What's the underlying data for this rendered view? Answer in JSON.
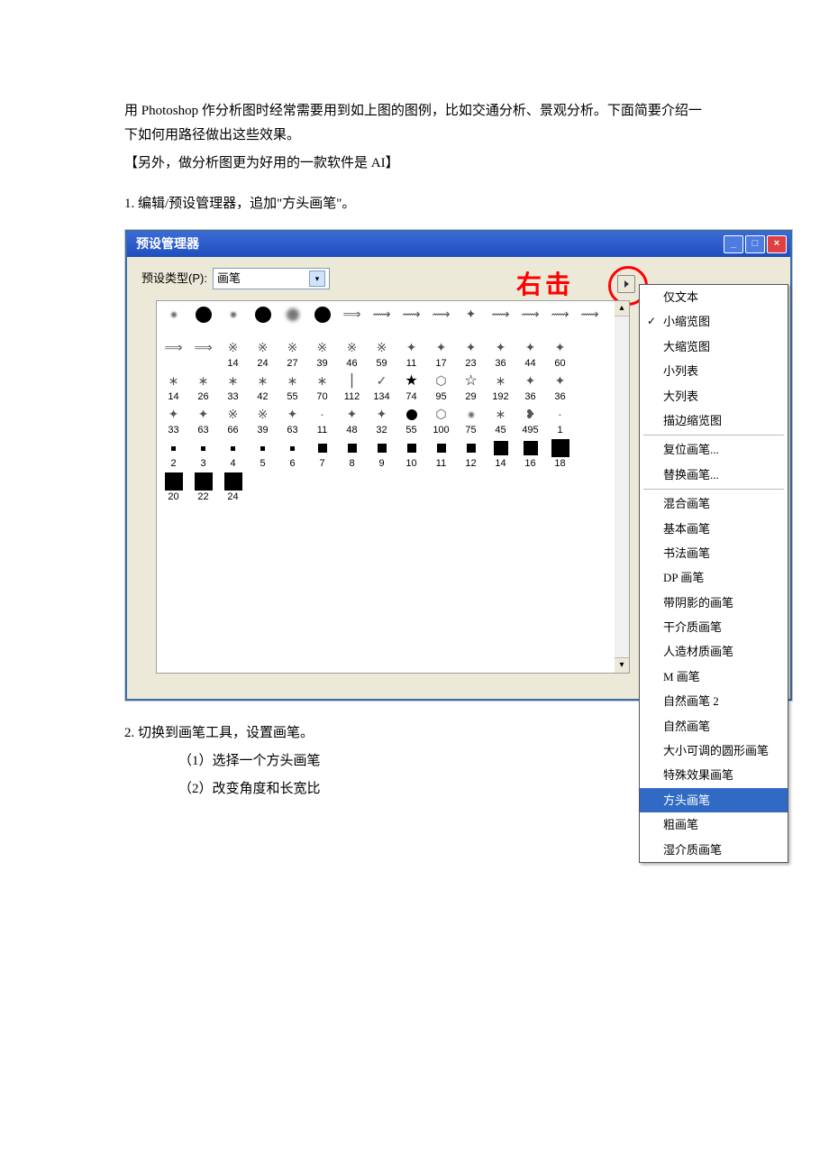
{
  "paragraphs": {
    "p1": "用 Photoshop 作分析图时经常需要用到如上图的图例，比如交通分析、景观分析。下面简要介绍一下如何用路径做出这些效果。",
    "p2": "【另外，做分析图更为好用的一款软件是 AI】",
    "p3": "1. 编辑/预设管理器，追加\"方头画笔\"。",
    "p4": "2. 切换到画笔工具，设置画笔。",
    "p5": "（1）选择一个方头画笔",
    "p6": "（2）改变角度和长宽比"
  },
  "dialog": {
    "title": "预设管理器",
    "preset_type_label": "预设类型(P):",
    "preset_type_value": "画笔",
    "annotation": "右击"
  },
  "brush_grid": [
    {
      "t": "circ-s",
      "l": ""
    },
    {
      "t": "circ-l",
      "l": ""
    },
    {
      "t": "circ-s",
      "l": ""
    },
    {
      "t": "circ-l",
      "l": ""
    },
    {
      "t": "circ-fuzz",
      "l": ""
    },
    {
      "t": "circ-l",
      "l": ""
    },
    {
      "t": "splat",
      "g": "⟹",
      "l": ""
    },
    {
      "t": "splat",
      "g": "⟿",
      "l": ""
    },
    {
      "t": "splat",
      "g": "⟿",
      "l": ""
    },
    {
      "t": "splat",
      "g": "⟿",
      "l": ""
    },
    {
      "t": "splat",
      "g": "✦",
      "l": ""
    },
    {
      "t": "splat",
      "g": "⟿",
      "l": ""
    },
    {
      "t": "splat",
      "g": "⟿",
      "l": ""
    },
    {
      "t": "splat",
      "g": "⟿",
      "l": ""
    },
    {
      "t": "splat",
      "g": "⟿",
      "l": ""
    },
    {
      "t": "splat",
      "g": "⟹",
      "l": ""
    },
    {
      "t": "splat",
      "g": "⟹",
      "l": ""
    },
    {
      "t": "splat",
      "g": "※",
      "l": "14"
    },
    {
      "t": "splat",
      "g": "※",
      "l": "24"
    },
    {
      "t": "splat",
      "g": "※",
      "l": "27"
    },
    {
      "t": "splat",
      "g": "※",
      "l": "39"
    },
    {
      "t": "splat",
      "g": "※",
      "l": "46"
    },
    {
      "t": "splat",
      "g": "※",
      "l": "59"
    },
    {
      "t": "splat",
      "g": "✦",
      "l": "11"
    },
    {
      "t": "splat",
      "g": "✦",
      "l": "17"
    },
    {
      "t": "splat",
      "g": "✦",
      "l": "23"
    },
    {
      "t": "splat",
      "g": "✦",
      "l": "36"
    },
    {
      "t": "splat",
      "g": "✦",
      "l": "44"
    },
    {
      "t": "splat",
      "g": "✦",
      "l": "60"
    },
    {
      "t": "",
      "l": ""
    },
    {
      "t": "splat",
      "g": "∗",
      "l": "14"
    },
    {
      "t": "splat",
      "g": "∗",
      "l": "26"
    },
    {
      "t": "splat",
      "g": "∗",
      "l": "33"
    },
    {
      "t": "splat",
      "g": "∗",
      "l": "42"
    },
    {
      "t": "splat",
      "g": "∗",
      "l": "55"
    },
    {
      "t": "splat",
      "g": "∗",
      "l": "70"
    },
    {
      "t": "splat",
      "g": "⎮",
      "l": "112"
    },
    {
      "t": "splat",
      "g": "✓",
      "l": "134"
    },
    {
      "t": "star",
      "g": "★",
      "l": "74"
    },
    {
      "t": "splat",
      "g": "⬡",
      "l": "95"
    },
    {
      "t": "star",
      "g": "☆",
      "l": "29"
    },
    {
      "t": "splat",
      "g": "∗",
      "l": "192"
    },
    {
      "t": "splat",
      "g": "✦",
      "l": "36"
    },
    {
      "t": "splat",
      "g": "✦",
      "l": "36"
    },
    {
      "t": "",
      "l": ""
    },
    {
      "t": "splat",
      "g": "✦",
      "l": "33"
    },
    {
      "t": "splat",
      "g": "✦",
      "l": "63"
    },
    {
      "t": "splat",
      "g": "※",
      "l": "66"
    },
    {
      "t": "splat",
      "g": "※",
      "l": "39"
    },
    {
      "t": "splat",
      "g": "✦",
      "l": "63"
    },
    {
      "t": "splat",
      "g": "·",
      "l": "11"
    },
    {
      "t": "splat",
      "g": "✦",
      "l": "48"
    },
    {
      "t": "splat",
      "g": "✦",
      "l": "32"
    },
    {
      "t": "circ-m",
      "l": "55"
    },
    {
      "t": "splat",
      "g": "⬡",
      "l": "100"
    },
    {
      "t": "circ-s",
      "l": "75"
    },
    {
      "t": "splat",
      "g": "∗",
      "l": "45"
    },
    {
      "t": "splat",
      "g": "❥",
      "l": "495"
    },
    {
      "t": "splat",
      "g": "·",
      "l": "1"
    },
    {
      "t": "",
      "l": ""
    },
    {
      "t": "sq-s",
      "l": "2"
    },
    {
      "t": "sq-s",
      "l": "3"
    },
    {
      "t": "sq-s",
      "l": "4"
    },
    {
      "t": "sq-s",
      "l": "5"
    },
    {
      "t": "sq-s",
      "l": "6"
    },
    {
      "t": "sq-m",
      "l": "7"
    },
    {
      "t": "sq-m",
      "l": "8"
    },
    {
      "t": "sq-m",
      "l": "9"
    },
    {
      "t": "sq-m",
      "l": "10"
    },
    {
      "t": "sq-m",
      "l": "11"
    },
    {
      "t": "sq-m",
      "l": "12"
    },
    {
      "t": "sq-l",
      "l": "14"
    },
    {
      "t": "sq-l",
      "l": "16"
    },
    {
      "t": "sq-xl",
      "l": "18"
    },
    {
      "t": "",
      "l": ""
    },
    {
      "t": "sq-xl",
      "l": "20"
    },
    {
      "t": "sq-xl",
      "l": "22"
    },
    {
      "t": "sq-xl",
      "l": "24"
    }
  ],
  "menu": {
    "items": [
      {
        "label": "仅文本",
        "checked": false
      },
      {
        "label": "小缩览图",
        "checked": true
      },
      {
        "label": "大缩览图",
        "checked": false
      },
      {
        "label": "小列表",
        "checked": false
      },
      {
        "label": "大列表",
        "checked": false
      },
      {
        "label": "描边缩览图",
        "checked": false
      },
      {
        "sep": true
      },
      {
        "label": "复位画笔...",
        "checked": false
      },
      {
        "label": "替换画笔...",
        "checked": false
      },
      {
        "sep": true
      },
      {
        "label": "混合画笔",
        "checked": false
      },
      {
        "label": "基本画笔",
        "checked": false
      },
      {
        "label": "书法画笔",
        "checked": false
      },
      {
        "label": "DP 画笔",
        "checked": false
      },
      {
        "label": "带阴影的画笔",
        "checked": false
      },
      {
        "label": "干介质画笔",
        "checked": false
      },
      {
        "label": "人造材质画笔",
        "checked": false
      },
      {
        "label": "M 画笔",
        "checked": false
      },
      {
        "label": "自然画笔 2",
        "checked": false
      },
      {
        "label": "自然画笔",
        "checked": false
      },
      {
        "label": "大小可调的圆形画笔",
        "checked": false
      },
      {
        "label": "特殊效果画笔",
        "checked": false
      },
      {
        "label": "方头画笔",
        "checked": false,
        "selected": true
      },
      {
        "label": "粗画笔",
        "checked": false
      },
      {
        "label": "湿介质画笔",
        "checked": false
      }
    ]
  }
}
